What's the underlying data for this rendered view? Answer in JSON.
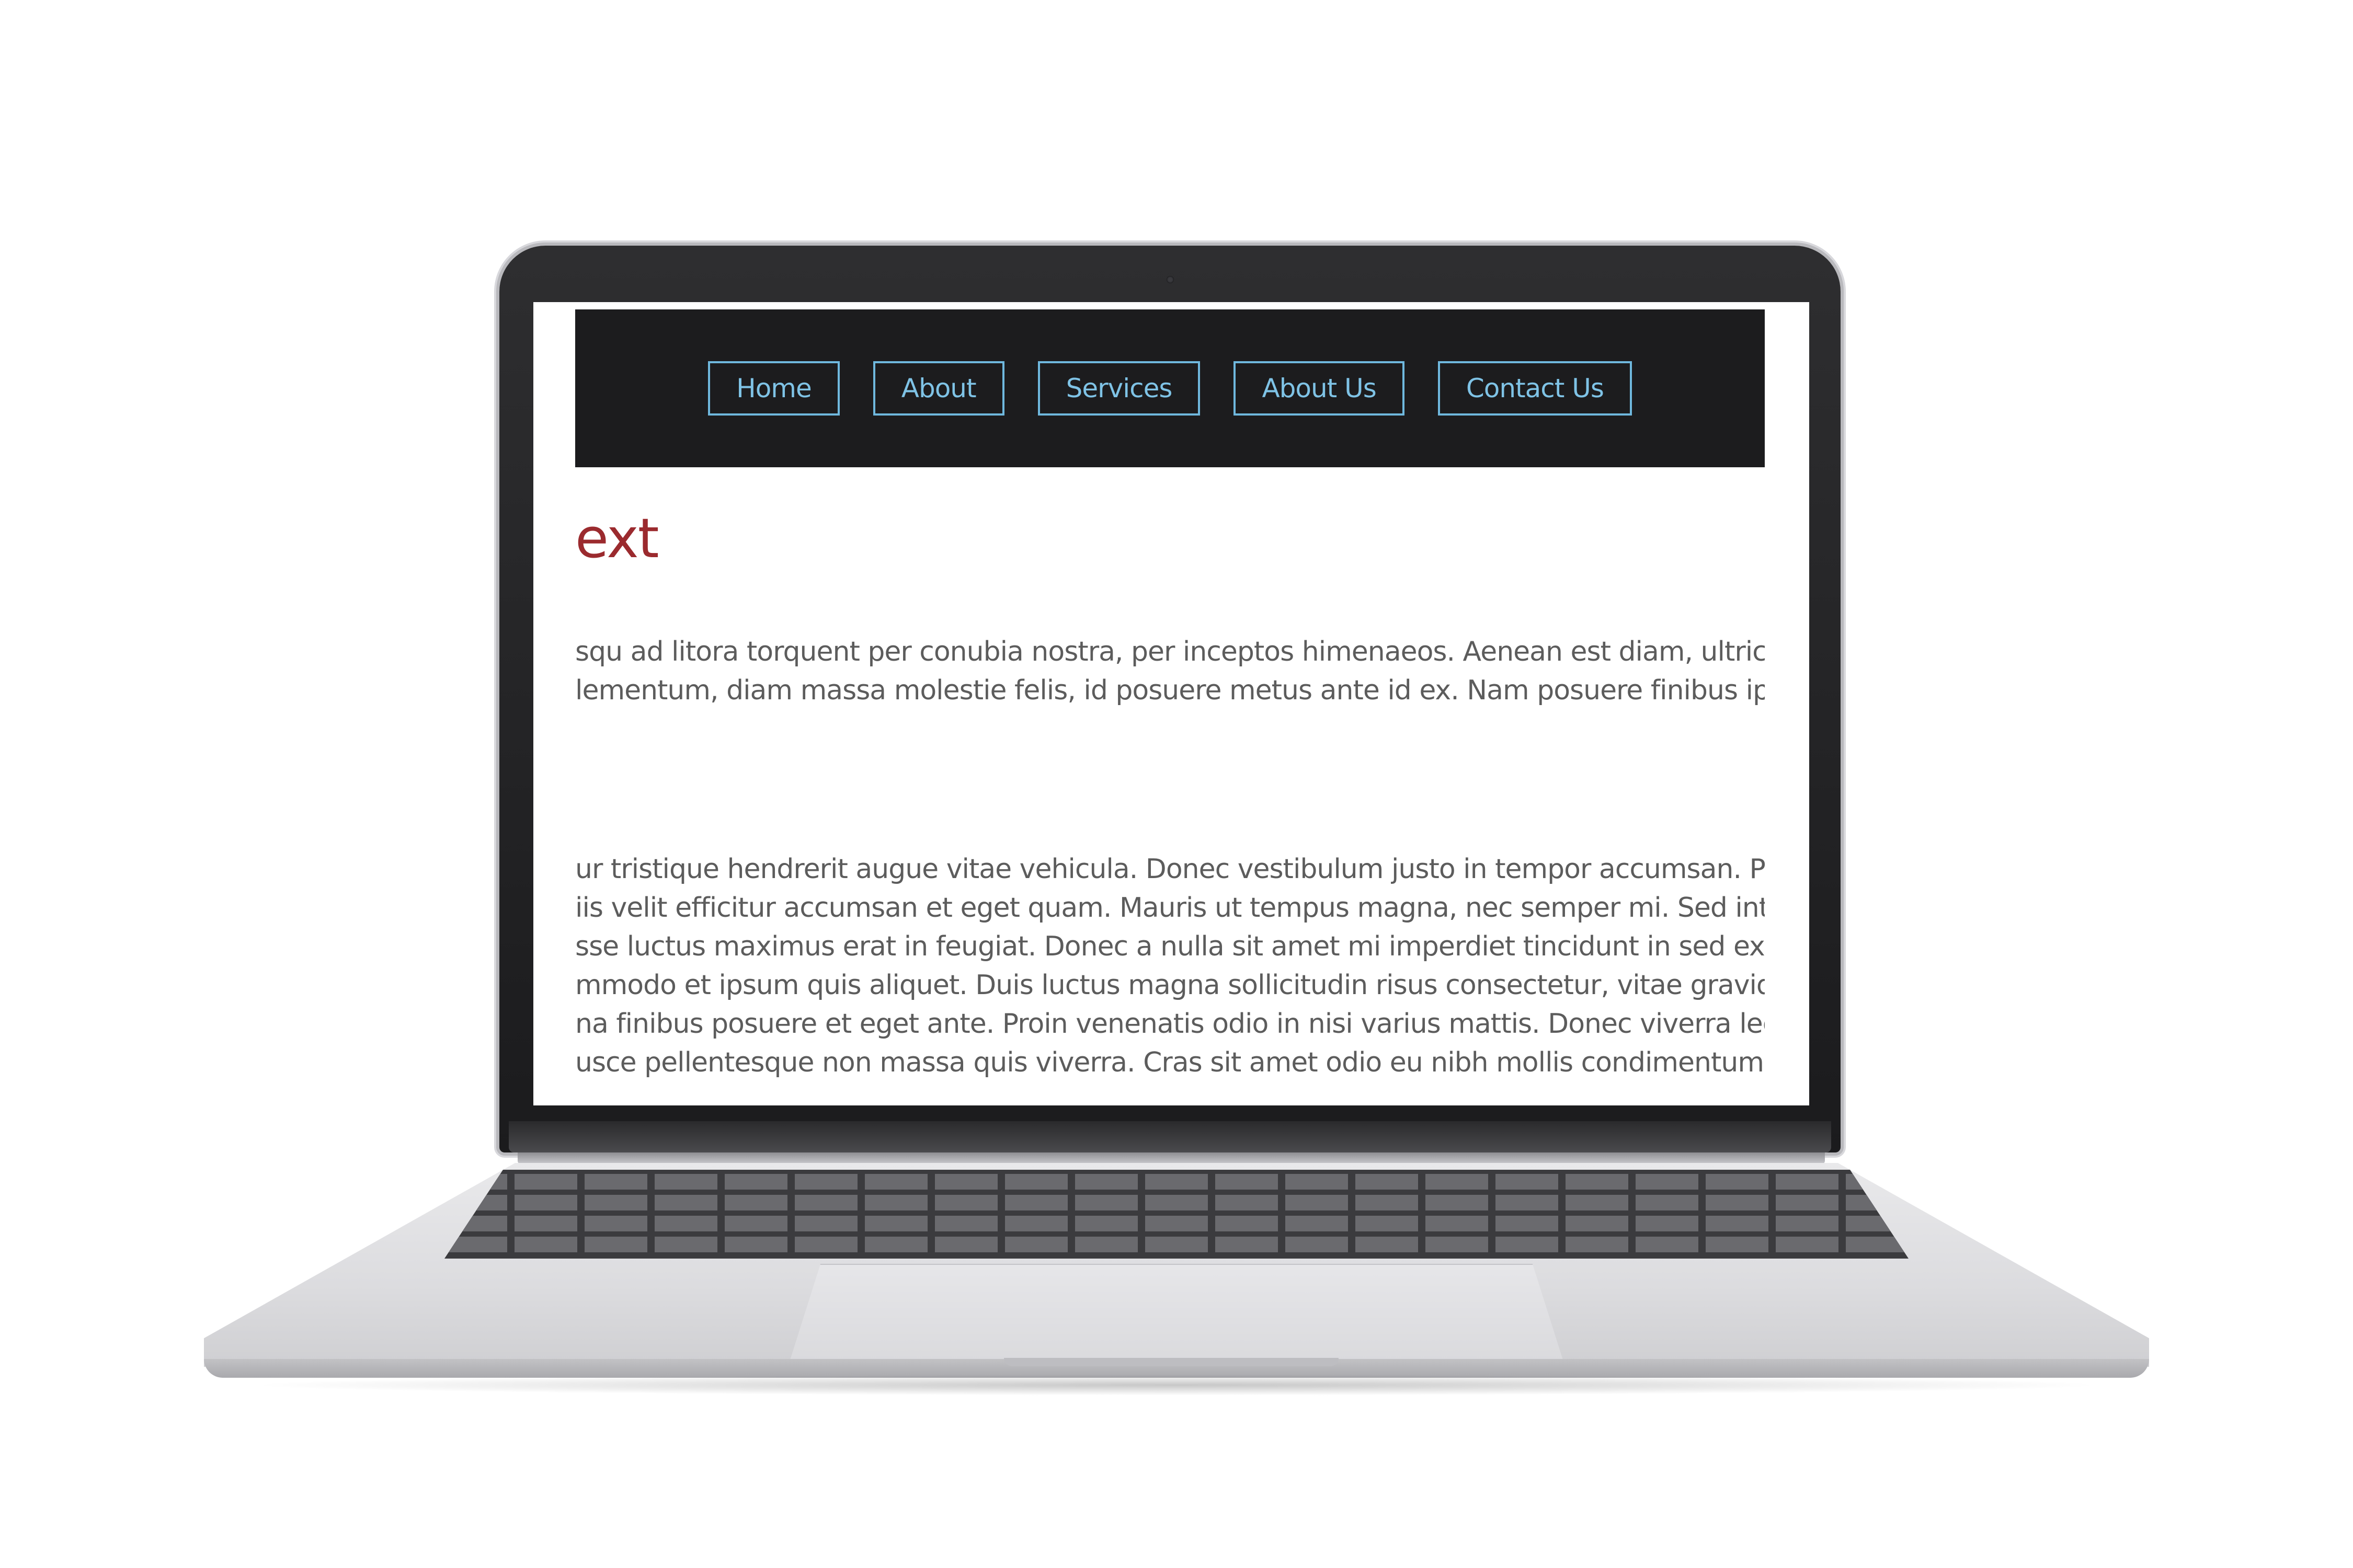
{
  "nav": {
    "items": [
      "Home",
      "About",
      "Services",
      "About Us",
      "Contact Us"
    ]
  },
  "content": {
    "heading": "ext",
    "paragraph_1": [
      "squ ad litora torquent per conubia nostra, per inceptos himenaeos. Aenean est diam, ultric",
      "lementum, diam massa molestie felis, id posuere metus ante id ex. Nam posuere finibus ip"
    ],
    "paragraph_2": [
      "ur tristique hendrerit augue vitae vehicula. Donec vestibulum justo in tempor accumsan. Pr",
      "iis velit efficitur accumsan et eget quam. Mauris ut tempus magna, nec semper mi. Sed int",
      "sse luctus maximus erat in feugiat. Donec a nulla sit amet mi imperdiet tincidunt in sed ex.",
      "mmodo et ipsum quis aliquet. Duis luctus magna sollicitudin risus consectetur, vitae gravid",
      "na finibus posuere et eget ante. Proin venenatis odio in nisi varius mattis. Donec viverra lec",
      "usce pellentesque non massa quis viverra. Cras sit amet odio eu nibh mollis condimentum"
    ]
  },
  "colors": {
    "nav_background": "#1c1c1e",
    "nav_button_text": "#7fc3e6",
    "nav_button_border": "#6fb8de",
    "heading": "#9b2a2e",
    "body_text": "#5c5c5c",
    "laptop_bezel": "#1b1b1d",
    "laptop_body": "#dcdcdf"
  }
}
